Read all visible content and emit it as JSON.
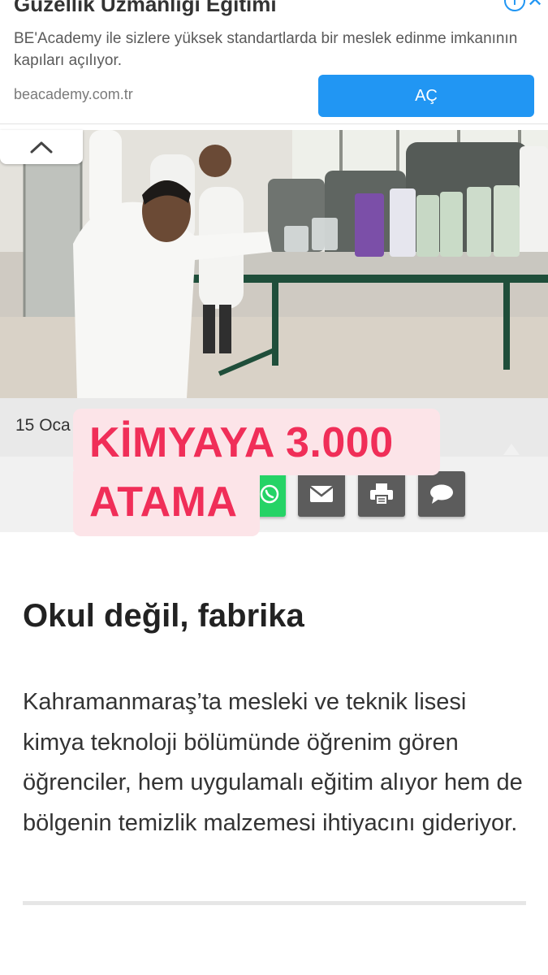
{
  "ad": {
    "title": "Güzellik Uzmanlığı Eğitimi",
    "description": "BE'Academy ile sizlere yüksek standartlarda bir meslek edinme imkanının kapıları açılıyor.",
    "url": "beacademy.com.tr",
    "button_label": "AÇ",
    "info_label": "i",
    "close_label": "✕",
    "accent_color": "#2196f3"
  },
  "article": {
    "date": "15 Oca",
    "headline": "Okul değil, fabrika",
    "body": "Kahramanmaraş’ta mesleki ve teknik lisesi kimya teknoloji bölümünde öğrenim gören öğrenciler, hem uygulamalı eğitim alıyor hem de bölgenin temizlik malzemesi ihtiyacını gideriyor."
  },
  "overlay": {
    "line1": "KİMYAYA 3.000",
    "line2": "ATAMA",
    "color": "#f02e58"
  },
  "share": {
    "icons": [
      "whatsapp-icon",
      "mail-icon",
      "print-icon",
      "comment-icon"
    ]
  },
  "colors": {
    "whatsapp": "#25d366",
    "share_gray": "#5c5c5c"
  }
}
